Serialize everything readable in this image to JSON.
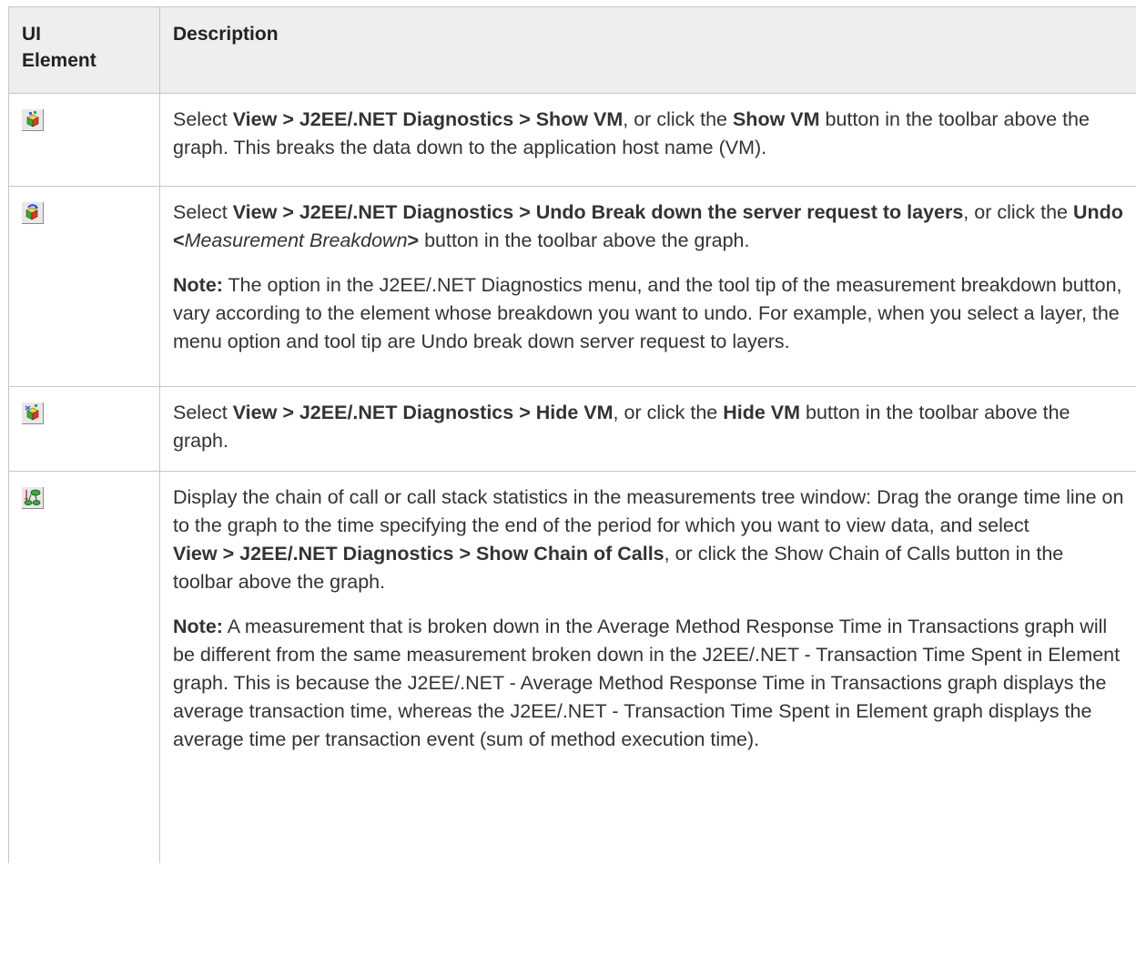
{
  "header": {
    "col1_line1": "UI",
    "col1_line2": "Element",
    "col2": "Description"
  },
  "rows": [
    {
      "icon": "show-vm-icon",
      "p1": {
        "t1": "Select ",
        "b1": "View > J2EE/.NET Diagnostics > Show VM",
        "t2": ", or click the ",
        "b2": "Show VM",
        "t3": " button in the toolbar above the graph. This breaks the data down to the application host name (VM)."
      }
    },
    {
      "icon": "undo-breakdown-icon",
      "p1": {
        "t1": "Select ",
        "b1": "View > J2EE/.NET Diagnostics > Undo Break down the server request to layers",
        "t2": ", or click the ",
        "b2": "Undo <",
        "i1": "Measurement Breakdown",
        "b3": ">",
        "t3": " button in the toolbar above the graph."
      },
      "p2": {
        "b1": "Note:",
        "t1": " The option in the J2EE/.NET Diagnostics menu, and the tool tip of the measurement breakdown button, vary according to the element whose breakdown you want to undo. For example, when you select a layer, the menu option and tool tip are Undo break down server request to layers."
      }
    },
    {
      "icon": "hide-vm-icon",
      "p1": {
        "t1": "Select ",
        "b1": "View > J2EE/.NET Diagnostics > Hide VM",
        "t2": ", or click the ",
        "b2": "Hide VM",
        "t3": " button in the toolbar above the graph."
      }
    },
    {
      "icon": "chain-of-calls-icon",
      "p1": {
        "t1": "Display the chain of call or call stack statistics in the measurements tree window: Drag the orange time line on to the graph to the time specifying the end of the period for which you want to view data, and select",
        "b1": "View > J2EE/.NET Diagnostics > Show Chain of Calls",
        "t2": ", or click the Show Chain of Calls button in the toolbar above the graph."
      },
      "p2": {
        "b1": "Note:",
        "t1": " A measurement that is broken down in the Average Method Response Time in Transactions graph will be different from the same measurement broken down in the J2EE/.NET - Transaction Time Spent in Element graph. This is because the J2EE/.NET - Average Method Response Time in Transactions graph displays the average transaction time, whereas the J2EE/.NET - Transaction Time Spent in Element graph displays the average time per transaction event (sum of method execution time)."
      }
    }
  ]
}
